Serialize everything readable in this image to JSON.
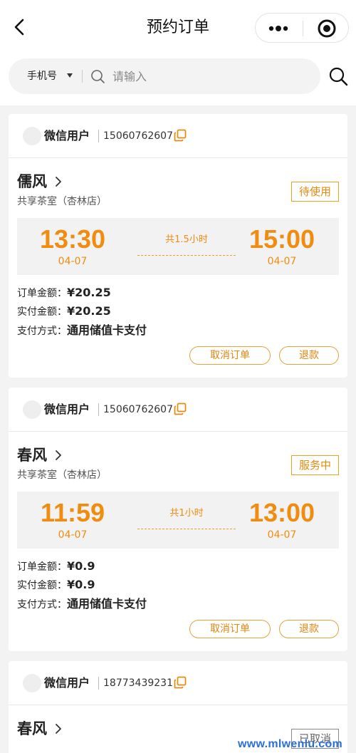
{
  "header": {
    "title": "预约订单",
    "back_icon": "chevron-left-icon",
    "more_icon": "more-dots-icon",
    "target_icon": "target-icon"
  },
  "search": {
    "type_label": "手机号",
    "placeholder": "请输入"
  },
  "labels": {
    "order_amount": "订单金额：",
    "paid_amount": "实付金额：",
    "pay_method": "支付方式："
  },
  "orders": [
    {
      "user": "微信用户",
      "phone": "15060762607",
      "room": "儒风",
      "store": "共享茶室（杏林店）",
      "status": "待使用",
      "start_time": "13:30",
      "start_date": "04-07",
      "end_time": "15:00",
      "end_date": "04-07",
      "duration": "共1.5小时",
      "order_amount": "¥20.25",
      "paid_amount": "¥20.25",
      "pay_method": "通用储值卡支付",
      "cancel_label": "取消订单",
      "refund_label": "退款"
    },
    {
      "user": "微信用户",
      "phone": "15060762607",
      "room": "春风",
      "store": "共享茶室（杏林店）",
      "status": "服务中",
      "start_time": "11:59",
      "start_date": "04-07",
      "end_time": "13:00",
      "end_date": "04-07",
      "duration": "共1小时",
      "order_amount": "¥0.9",
      "paid_amount": "¥0.9",
      "pay_method": "通用储值卡支付",
      "cancel_label": "取消订单",
      "refund_label": "退款"
    },
    {
      "user": "微信用户",
      "phone": "18773439231",
      "room": "春风",
      "status": "已取消"
    }
  ],
  "watermark": "www.mlwenlu.com",
  "colors": {
    "accent": "#f08c10",
    "border_accent": "#f0a020",
    "background": "#f3f3f3",
    "watermark": "#2a6fd8"
  }
}
